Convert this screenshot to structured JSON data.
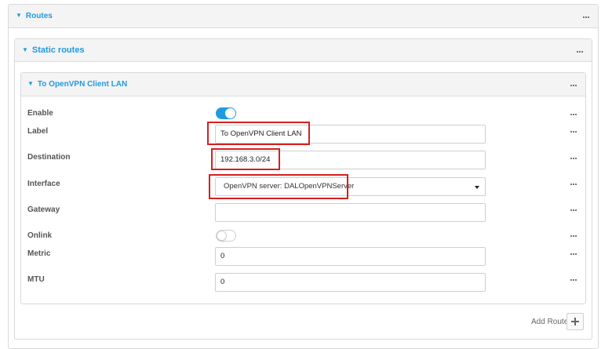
{
  "routes": {
    "title": "Routes",
    "static_routes": {
      "title": "Static routes",
      "route": {
        "title": "To OpenVPN Client LAN",
        "fields": {
          "enable": {
            "label": "Enable",
            "state": "on"
          },
          "label": {
            "label": "Label",
            "value": "To OpenVPN Client LAN"
          },
          "destination": {
            "label": "Destination",
            "value": "192.168.3.0/24"
          },
          "interface": {
            "label": "Interface",
            "value": "OpenVPN server: DALOpenVPNServer"
          },
          "gateway": {
            "label": "Gateway",
            "value": ""
          },
          "onlink": {
            "label": "Onlink",
            "state": "off"
          },
          "metric": {
            "label": "Metric",
            "value": "0"
          },
          "mtu": {
            "label": "MTU",
            "value": "0"
          }
        }
      },
      "add_route_label": "Add Route"
    }
  },
  "icons": {
    "collapse": "caret-down-icon",
    "more": "more-options-icon",
    "add": "plus-icon",
    "select": "chevron-down-icon"
  },
  "colors": {
    "accent": "#1e9be0",
    "highlight": "#d42020",
    "toggle_off": "#ffffff"
  }
}
